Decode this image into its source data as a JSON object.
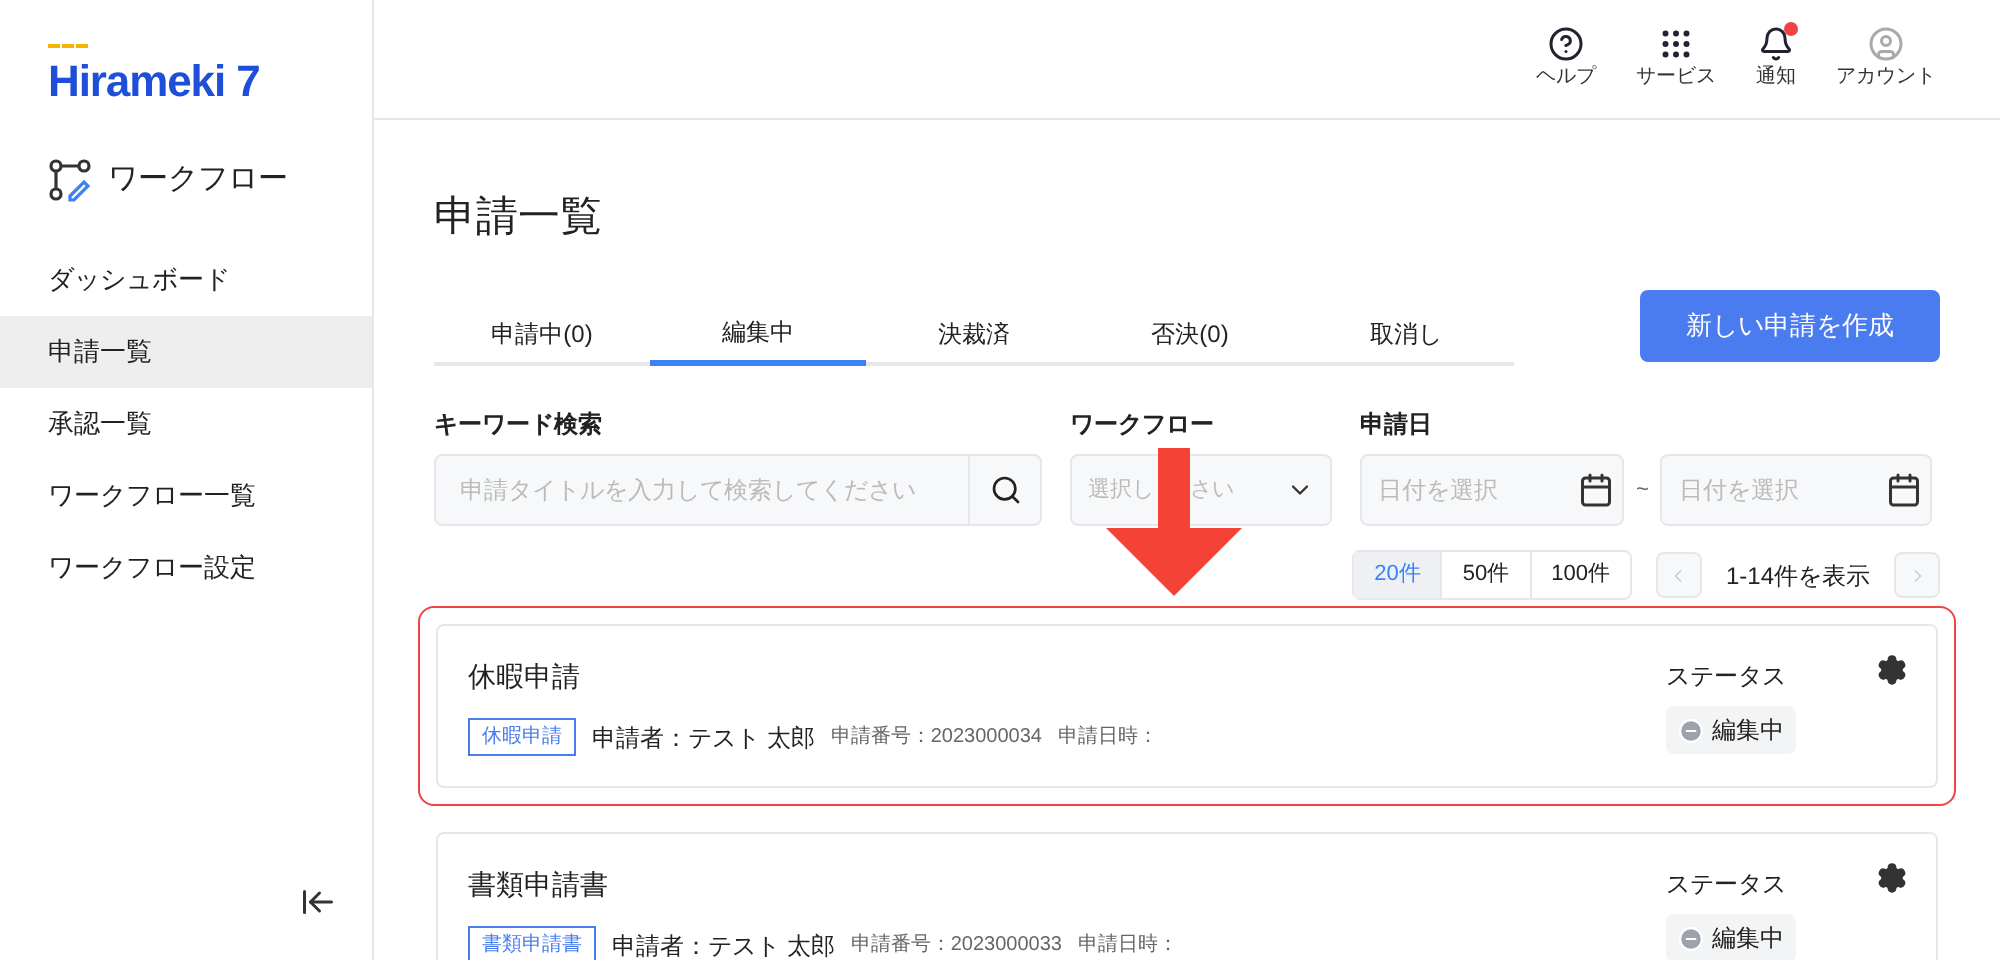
{
  "logo": {
    "text": "Hirameki 7"
  },
  "app_name": "ワークフロー",
  "sidebar": {
    "items": [
      {
        "label": "ダッシュボード",
        "selected": false
      },
      {
        "label": "申請一覧",
        "selected": true
      },
      {
        "label": "承認一覧",
        "selected": false
      },
      {
        "label": "ワークフロー一覧",
        "selected": false
      },
      {
        "label": "ワークフロー設定",
        "selected": false
      }
    ]
  },
  "header": {
    "actions": [
      {
        "kind": "help",
        "label": "ヘルプ",
        "badge": false
      },
      {
        "kind": "services",
        "label": "サービス",
        "badge": false
      },
      {
        "kind": "notifications",
        "label": "通知",
        "badge": true
      },
      {
        "kind": "account",
        "label": "アカウント",
        "badge": false
      }
    ]
  },
  "page_title": "申請一覧",
  "tabs": [
    {
      "label": "申請中(0)",
      "selected": false
    },
    {
      "label": "編集中",
      "selected": true
    },
    {
      "label": "決裁済",
      "selected": false
    },
    {
      "label": "否決(0)",
      "selected": false
    },
    {
      "label": "取消し",
      "selected": false
    }
  ],
  "create_button": "新しい申請を作成",
  "filters": {
    "keyword": {
      "label": "キーワード検索",
      "placeholder": "申請タイトルを入力して検索してください"
    },
    "workflow": {
      "label": "ワークフロー",
      "placeholder_parts": [
        "選択し",
        "さい"
      ]
    },
    "date": {
      "label": "申請日",
      "from_placeholder": "日付を選択",
      "separator": "~",
      "to_placeholder": "日付を選択"
    }
  },
  "page_sizes": [
    {
      "label": "20件",
      "selected": true
    },
    {
      "label": "50件",
      "selected": false
    },
    {
      "label": "100件",
      "selected": false
    }
  ],
  "range": "1-14件を表示",
  "requests": [
    {
      "title": "休暇申請",
      "tag": "休暇申請",
      "applicant": "申請者：テスト 太郎",
      "number": "申請番号：2023000034",
      "date": "申請日時：",
      "status_label": "ステータス",
      "status": "編集中",
      "highlighted": true
    },
    {
      "title": "書類申請書",
      "tag": "書類申請書",
      "applicant": "申請者：テスト 太郎",
      "number": "申請番号：2023000033",
      "date": "申請日時：",
      "status_label": "ステータス",
      "status": "編集中",
      "highlighted": false
    }
  ]
}
